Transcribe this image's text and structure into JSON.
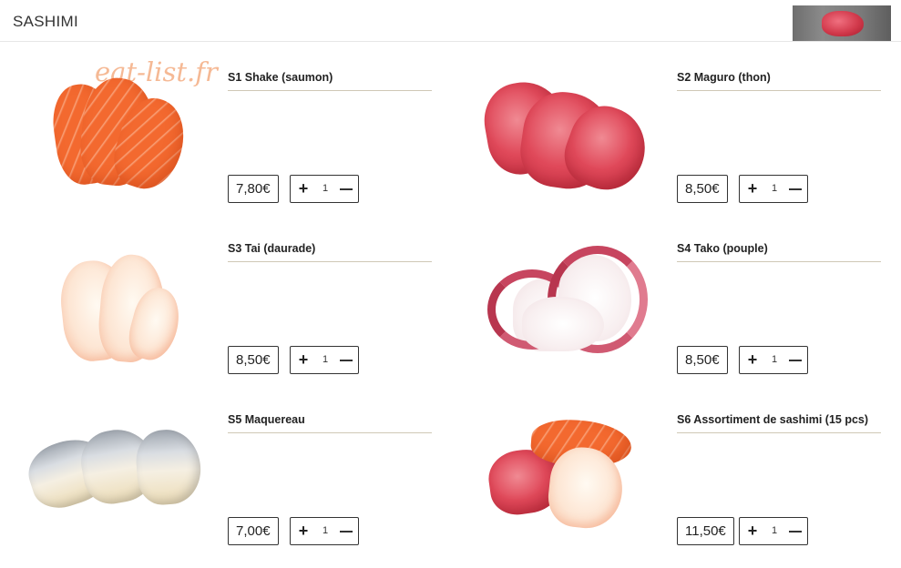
{
  "header": {
    "title": "SASHIMI"
  },
  "watermark": "eat-list.fr",
  "stepper": {
    "plus_label": "+",
    "default_qty": "1"
  },
  "items": [
    {
      "name": "S1 Shake (saumon)",
      "price": "7,80€",
      "qty": "1"
    },
    {
      "name": "S2 Maguro (thon)",
      "price": "8,50€",
      "qty": "1"
    },
    {
      "name": "S3 Tai (daurade)",
      "price": "8,50€",
      "qty": "1"
    },
    {
      "name": "S4 Tako (pouple)",
      "price": "8,50€",
      "qty": "1"
    },
    {
      "name": "S5 Maquereau",
      "price": "7,00€",
      "qty": "1"
    },
    {
      "name": "S6 Assortiment de sashimi (15 pcs)",
      "price": "11,50€",
      "qty": "1"
    }
  ]
}
